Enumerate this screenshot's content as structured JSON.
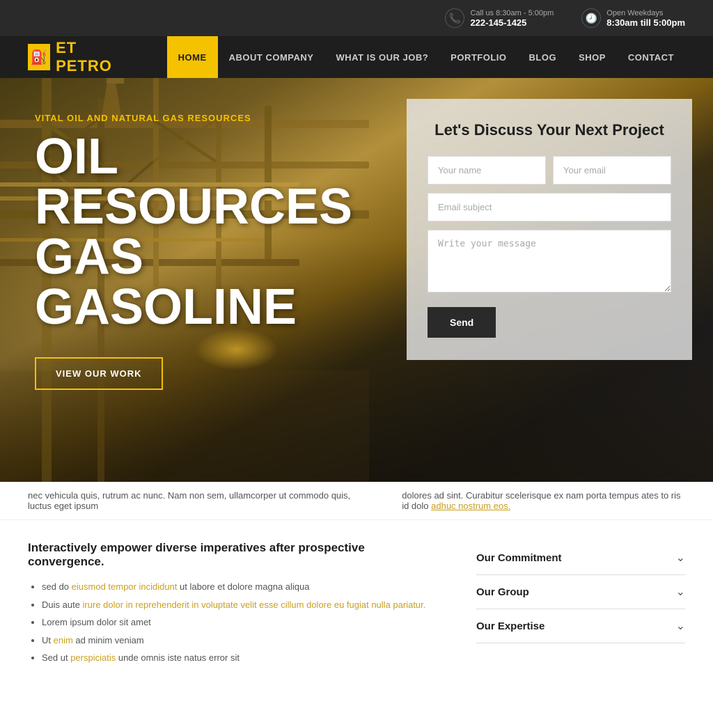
{
  "brand": {
    "icon": "⛽",
    "name_et": "ET ",
    "name_petro": "PETRO"
  },
  "topbar": {
    "phone_icon": "📞",
    "phone_label": "Call us 8:30am - 5:00pm",
    "phone_number": "222-145-1425",
    "clock_icon": "🕗",
    "hours_label": "Open Weekdays",
    "hours_value": "8:30am till 5:00pm"
  },
  "nav": {
    "items": [
      {
        "label": "HOME",
        "active": true
      },
      {
        "label": "ABOUT COMPANY",
        "active": false
      },
      {
        "label": "WHAT IS OUR JOB?",
        "active": false
      },
      {
        "label": "PORTFOLIO",
        "active": false
      },
      {
        "label": "BLOG",
        "active": false
      },
      {
        "label": "SHOP",
        "active": false
      },
      {
        "label": "CONTACT",
        "active": false
      }
    ]
  },
  "hero": {
    "subtitle": "VITAL OIL AND NATURAL GAS RESOURCES",
    "line1": "OIL",
    "line2": "RESOURCES",
    "line3": "GAS",
    "line4": "GASOLINE",
    "cta_label": "VIEW OUR WORK"
  },
  "contact_form": {
    "title": "Let's Discuss Your Next Project",
    "name_placeholder": "Your name",
    "email_placeholder": "Your email",
    "subject_placeholder": "Email subject",
    "message_placeholder": "Write your message",
    "send_label": "Send"
  },
  "text_strip": {
    "left": "nec vehicula quis, rutrum ac nunc. Nam non sem, ullamcorper ut commodo quis, luctus eget ipsum",
    "right": "dolores ad sint. Curabitur scelerisque ex nam porta tempus ates to ris id dolo adhuc nostrum eos.",
    "right_link": "adhuc nostrum eos."
  },
  "main": {
    "heading": "Interactively empower diverse imperatives after prospective convergence.",
    "bullets": [
      {
        "text": "sed do eiusmod tempor incididunt ut labore et dolore magna aliqua",
        "link_start": 7,
        "link_text": "eiusmod tempor incididunt"
      },
      {
        "text": "Duis aute irure dolor in reprehenderit in voluptate velit esse cillum dolore eu fugiat nulla pariatur.",
        "link_text": "irure dolor in reprehenderit in voluptate velit esse cillum dolore eu fugiat nulla pariatur."
      },
      {
        "text": "Lorem ipsum dolor sit amet"
      },
      {
        "text": "Ut enim ad minim veniam",
        "link_text": "enim"
      },
      {
        "text": "Sed ut perspiciatis unde omnis iste natus error sit",
        "link_text": "perspiciatis"
      }
    ]
  },
  "accordion": {
    "items": [
      {
        "label": "Our Commitment"
      },
      {
        "label": "Our Group"
      },
      {
        "label": "Our Expertise"
      }
    ]
  }
}
